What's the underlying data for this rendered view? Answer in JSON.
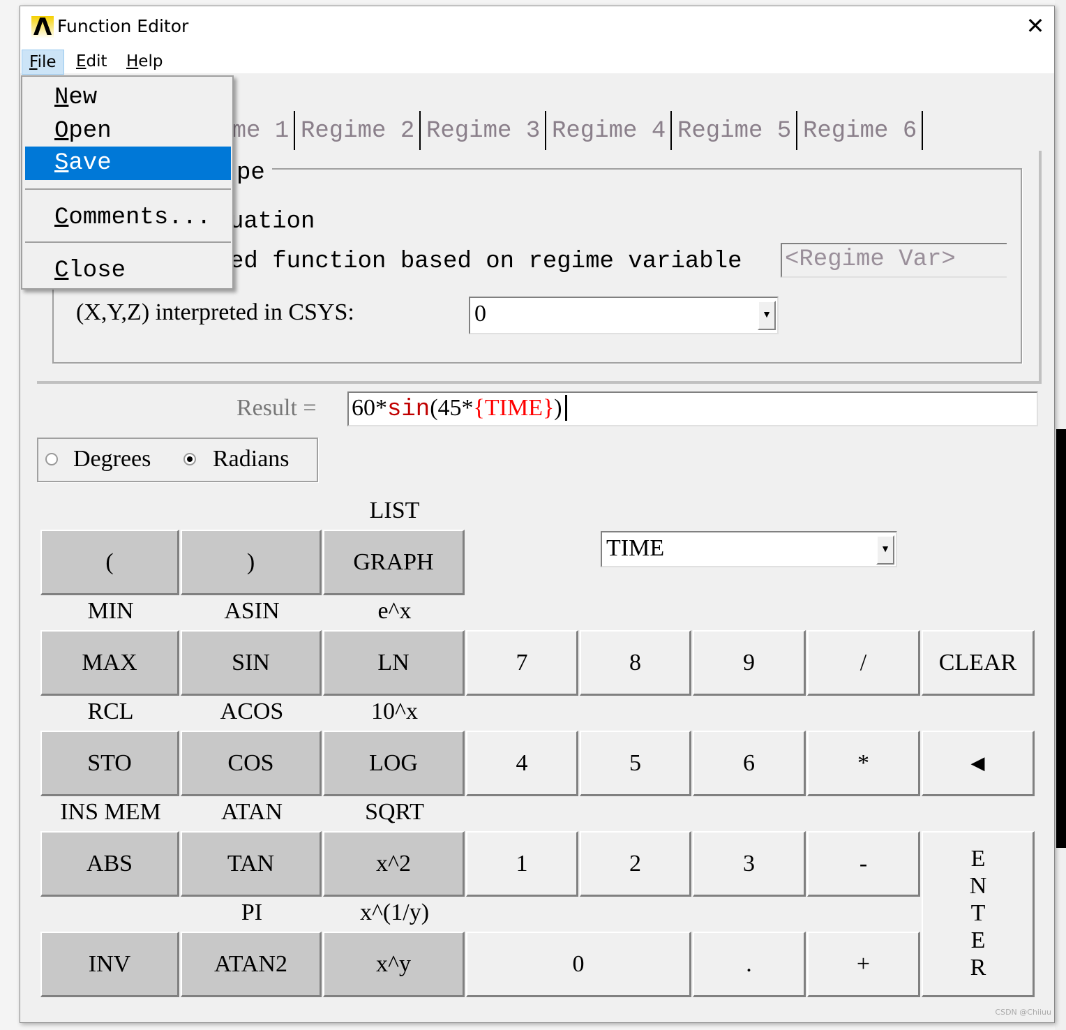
{
  "window": {
    "title": "Function Editor",
    "close_icon": "close-icon"
  },
  "menubar": [
    {
      "label": "File",
      "mnemonic": "F",
      "rest": "ile"
    },
    {
      "label": "Edit",
      "mnemonic": "E",
      "rest": "dit"
    },
    {
      "label": "Help",
      "mnemonic": "H",
      "rest": "elp"
    }
  ],
  "file_menu": [
    {
      "mnemonic": "N",
      "rest": "ew"
    },
    {
      "mnemonic": "O",
      "rest": "pen"
    },
    {
      "mnemonic": "S",
      "rest": "ave",
      "highlighted": true
    },
    {
      "mnemonic": "C",
      "rest": "omments..."
    },
    {
      "mnemonic": "C",
      "rest": "lose"
    }
  ],
  "tabs": [
    "Regime 1",
    "Regime 2",
    "Regime 3",
    "Regime 4",
    "Regime 5",
    "Regime 6"
  ],
  "function_type": {
    "group_label_fragment": "pe",
    "option1_fragment": "uation",
    "option2_fragment": "ed function based on regime variable",
    "regime_var_placeholder": "<Regime Var>",
    "csys_label": "(X,Y,Z) interpreted in CSYS:",
    "csys_value": "0"
  },
  "result": {
    "label": "Result =",
    "parts": [
      {
        "text": "60*",
        "color": "#000000"
      },
      {
        "text": "sin",
        "color": "#c00000"
      },
      {
        "text": "(45*",
        "color": "#000000"
      },
      {
        "text": "{TIME}",
        "color": "#ff0000"
      },
      {
        "text": ")",
        "color": "#000000"
      }
    ]
  },
  "angle_units": {
    "degrees": "Degrees",
    "radians": "Radians",
    "selected": "Radians"
  },
  "variable_dropdown": "TIME",
  "keypad": {
    "shift_labels": [
      "LIST",
      "MIN",
      "ASIN",
      "e^x",
      "RCL",
      "ACOS",
      "10^x",
      "INS MEM",
      "ATAN",
      "SQRT",
      "PI",
      "x^(1/y)"
    ],
    "keys": [
      "(",
      ")",
      "GRAPH",
      "MAX",
      "SIN",
      "LN",
      "7",
      "8",
      "9",
      "/",
      "CLEAR",
      "STO",
      "COS",
      "LOG",
      "4",
      "5",
      "6",
      "*",
      "backspace",
      "ABS",
      "TAN",
      "x^2",
      "1",
      "2",
      "3",
      "-",
      "ENTER",
      "INV",
      "ATAN2",
      "x^y",
      "0",
      ".",
      "+"
    ]
  },
  "watermark": "CSDN @Chiiuu"
}
